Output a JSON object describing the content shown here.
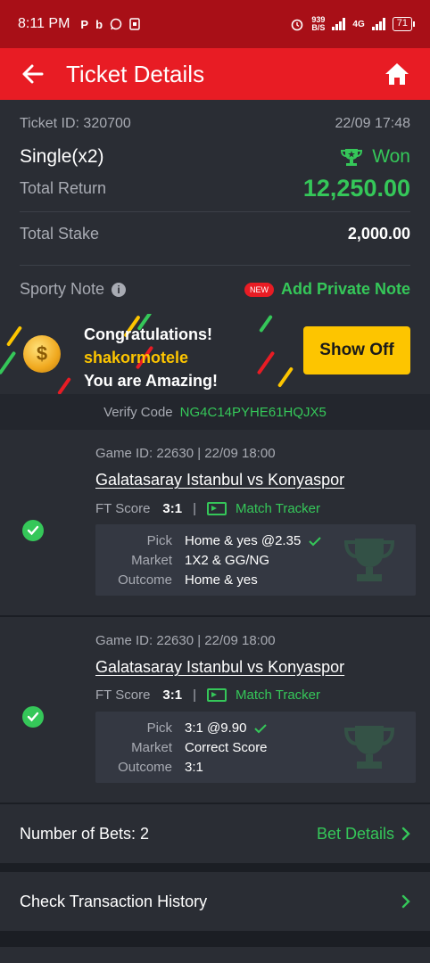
{
  "status_bar": {
    "time": "8:11 PM",
    "notif_icons": [
      "P",
      "b",
      "whatsapp-icon",
      "sim-icon"
    ],
    "net_speed_top": "939",
    "net_speed_bottom": "B/S",
    "network": "4G",
    "battery": "71"
  },
  "app_bar": {
    "title": "Ticket Details"
  },
  "ticket": {
    "id_label": "Ticket ID: 320700",
    "date": "22/09 17:48",
    "type": "Single(x2)",
    "status": "Won",
    "total_return_label": "Total Return",
    "total_return": "12,250.00",
    "total_stake_label": "Total Stake",
    "total_stake": "2,000.00",
    "sporty_note_label": "Sporty Note",
    "new_badge": "NEW",
    "add_note": "Add Private Note"
  },
  "banner": {
    "line1": "Congratulations!",
    "username": "shakormotele",
    "line3": "You are Amazing!",
    "button": "Show Off"
  },
  "verify": {
    "label": "Verify Code",
    "code": "NG4C14PYHE61HQJX5"
  },
  "bets": [
    {
      "game": "Game ID: 22630 | 22/09 18:00",
      "match": "Galatasaray Istanbul vs Konyaspor",
      "ft_label": "FT Score",
      "ft_score": "3:1",
      "tracker": "Match Tracker",
      "pick_label": "Pick",
      "pick": "Home & yes @2.35",
      "market_label": "Market",
      "market": "1X2 & GG/NG",
      "outcome_label": "Outcome",
      "outcome": "Home & yes"
    },
    {
      "game": "Game ID: 22630 | 22/09 18:00",
      "match": "Galatasaray Istanbul vs Konyaspor",
      "ft_label": "FT Score",
      "ft_score": "3:1",
      "tracker": "Match Tracker",
      "pick_label": "Pick",
      "pick": "3:1 @9.90",
      "market_label": "Market",
      "market": "Correct Score",
      "outcome_label": "Outcome",
      "outcome": "3:1"
    }
  ],
  "footer": {
    "num_bets": "Number of Bets: 2",
    "bet_details": "Bet Details",
    "transaction": "Check Transaction History"
  },
  "colors": {
    "header": "#e81c24",
    "status_bar": "#a80f17",
    "accent_green": "#35c759",
    "button_yellow": "#fdc500",
    "panel": "#2a2d34",
    "background": "#1b1e24"
  }
}
